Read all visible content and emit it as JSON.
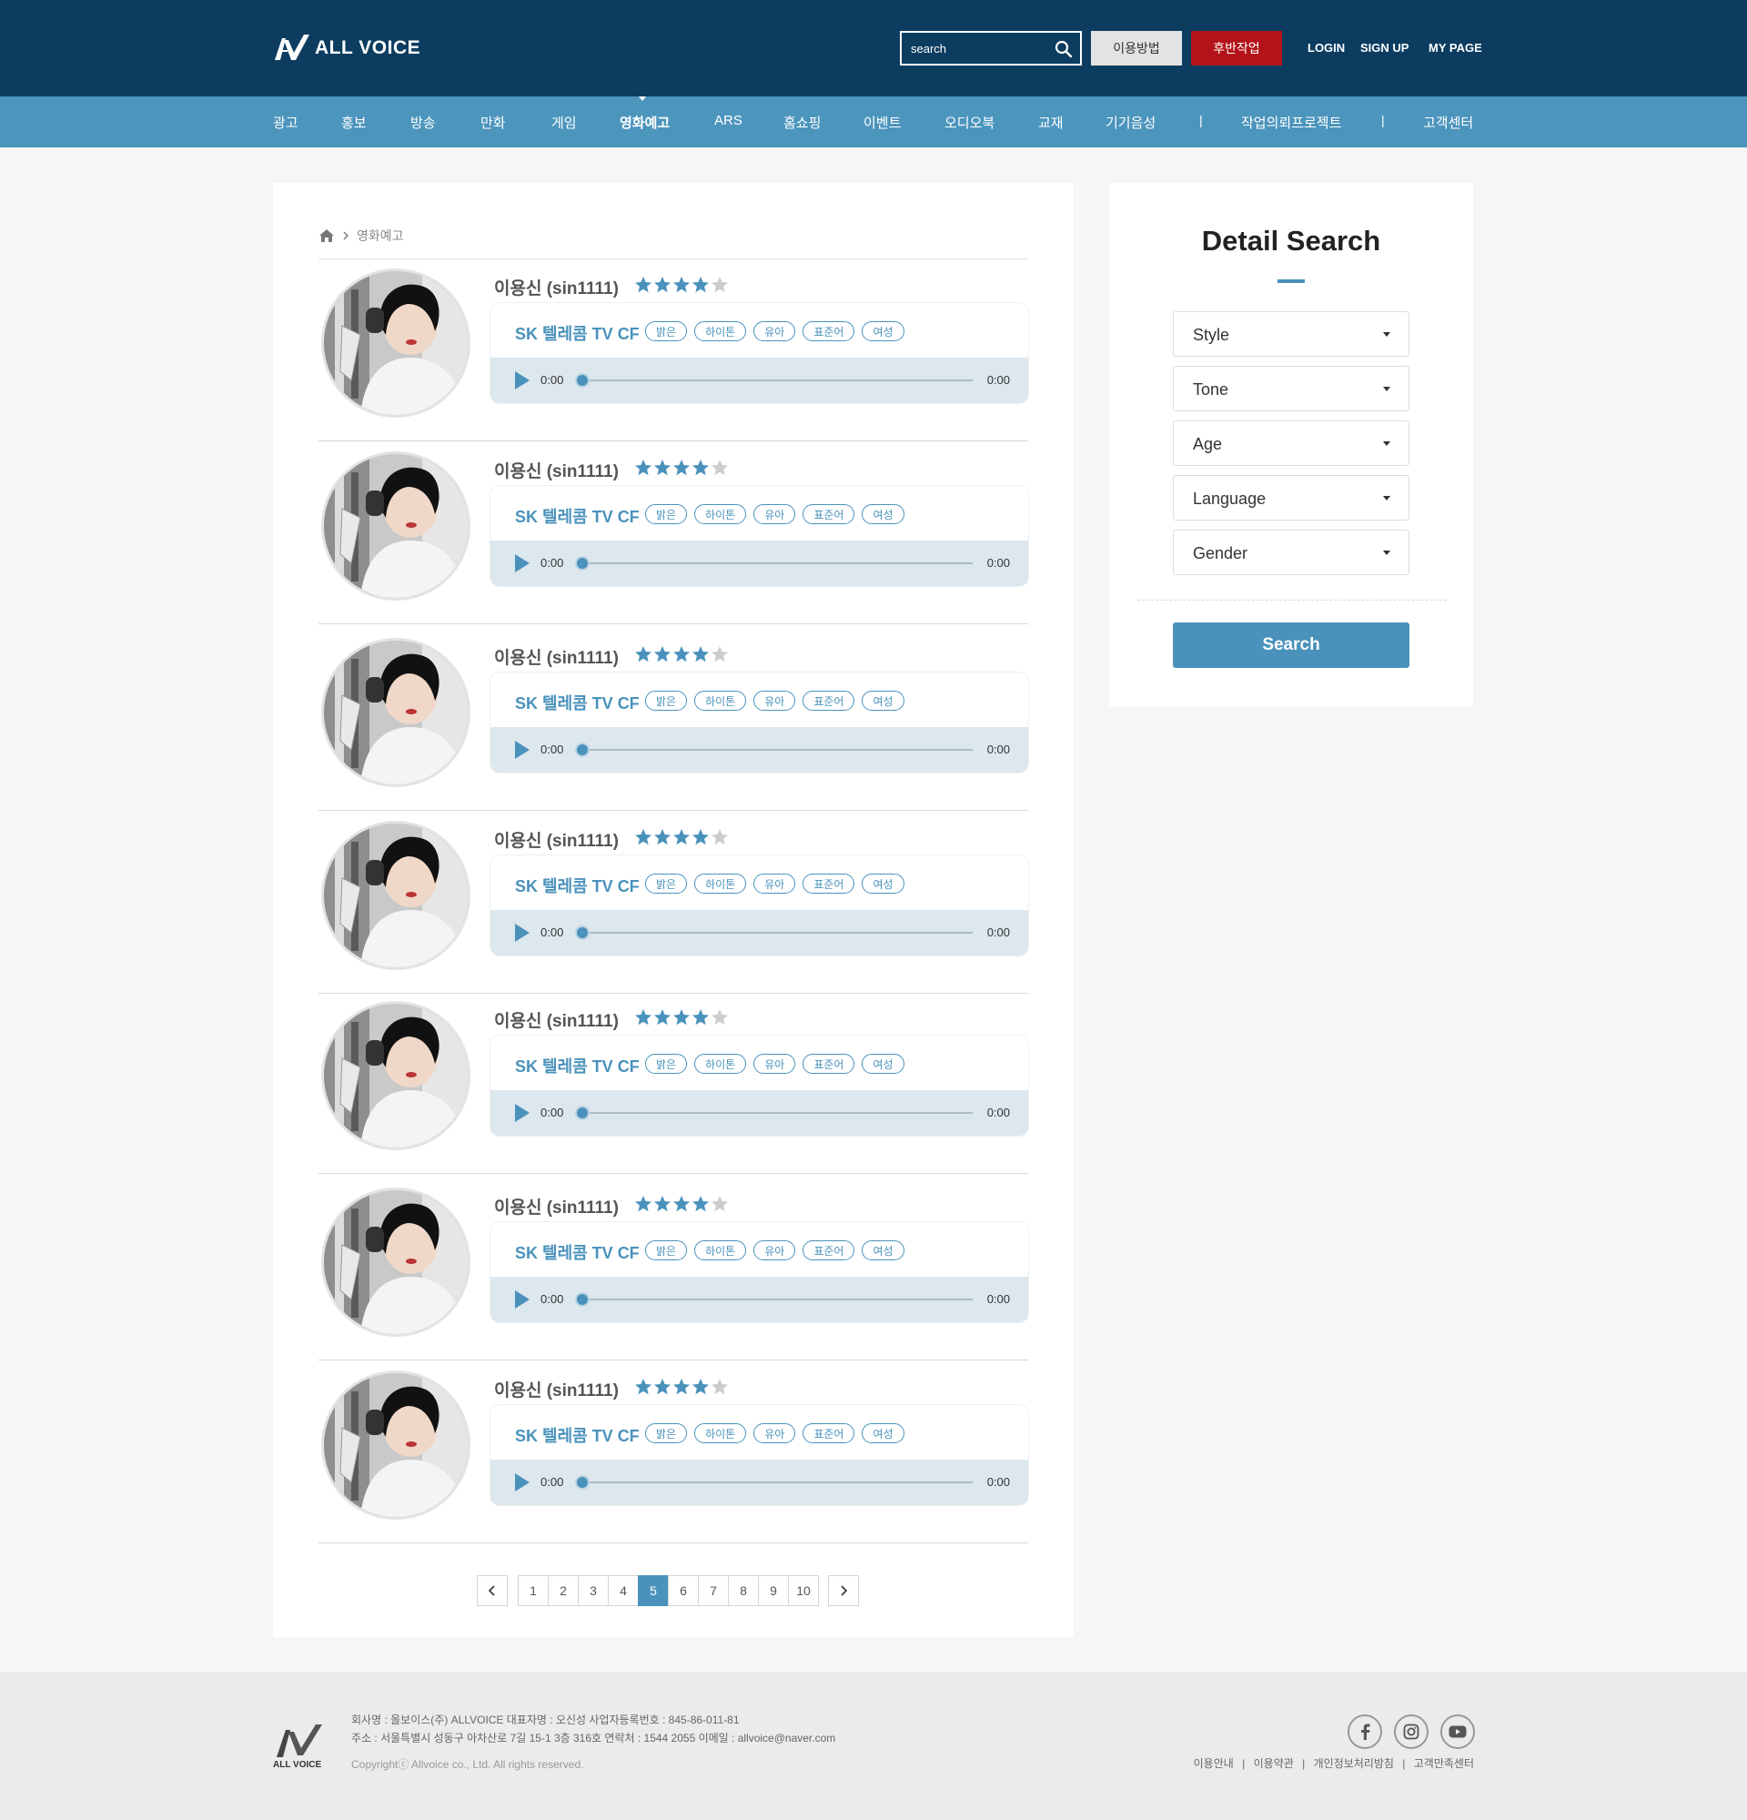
{
  "header": {
    "logo_text": "ALL VOICE",
    "search_placeholder": "search",
    "btn_guide": "이용방법",
    "btn_post": "후반작업",
    "link_login": "LOGIN",
    "link_signup": "SIGN UP",
    "link_mypage": "MY PAGE"
  },
  "nav": {
    "items": [
      "광고",
      "홍보",
      "방송",
      "만화",
      "게임",
      "영화예고",
      "ARS",
      "홈쇼핑",
      "이벤트",
      "오디오북",
      "교재",
      "기기음성",
      "작업의뢰프로젝트",
      "고객센터"
    ],
    "separator": "|",
    "active": "영화예고"
  },
  "breadcrumb": {
    "current": "영화예고"
  },
  "items": [
    {
      "name": "이용신 (sin1111)",
      "rating": 4,
      "title": "SK 텔레콤 TV CF",
      "tags": [
        "밝은",
        "하이톤",
        "유아",
        "표준어",
        "여성"
      ],
      "current_time": "0:00",
      "duration": "0:00"
    },
    {
      "name": "이용신 (sin1111)",
      "rating": 4,
      "title": "SK 텔레콤 TV CF",
      "tags": [
        "밝은",
        "하이톤",
        "유아",
        "표준어",
        "여성"
      ],
      "current_time": "0:00",
      "duration": "0:00"
    },
    {
      "name": "이용신 (sin1111)",
      "rating": 4,
      "title": "SK 텔레콤 TV CF",
      "tags": [
        "밝은",
        "하이톤",
        "유아",
        "표준어",
        "여성"
      ],
      "current_time": "0:00",
      "duration": "0:00"
    },
    {
      "name": "이용신 (sin1111)",
      "rating": 4,
      "title": "SK 텔레콤 TV CF",
      "tags": [
        "밝은",
        "하이톤",
        "유아",
        "표준어",
        "여성"
      ],
      "current_time": "0:00",
      "duration": "0:00"
    },
    {
      "name": "이용신 (sin1111)",
      "rating": 4,
      "title": "SK 텔레콤 TV CF",
      "tags": [
        "밝은",
        "하이톤",
        "유아",
        "표준어",
        "여성"
      ],
      "current_time": "0:00",
      "duration": "0:00"
    },
    {
      "name": "이용신 (sin1111)",
      "rating": 4,
      "title": "SK 텔레콤 TV CF",
      "tags": [
        "밝은",
        "하이톤",
        "유아",
        "표준어",
        "여성"
      ],
      "current_time": "0:00",
      "duration": "0:00"
    },
    {
      "name": "이용신 (sin1111)",
      "rating": 4,
      "title": "SK 텔레콤 TV CF",
      "tags": [
        "밝은",
        "하이톤",
        "유아",
        "표준어",
        "여성"
      ],
      "current_time": "0:00",
      "duration": "0:00"
    }
  ],
  "pagination": {
    "pages": [
      "1",
      "2",
      "3",
      "4",
      "5",
      "6",
      "7",
      "8",
      "9",
      "10"
    ],
    "current": "5"
  },
  "detail_search": {
    "title": "Detail Search",
    "filters": [
      "Style",
      "Tone",
      "Age",
      "Language",
      "Gender"
    ],
    "button": "Search"
  },
  "footer": {
    "logo_text": "ALL VOICE",
    "line1": "회사명 : 올보이스(주) ALLVOICE  대표자명 : 오신성  사업자등록번호 : 845-86-011-81",
    "line2": "주소 : 서울특별시 성동구 아차산로 7길 15-1 3층 316호  연락처 : 1544 2055  이메일 : allvoice@naver.com",
    "copyright": "Copyrightⓒ Allvoice co., Ltd. All rights reserved.",
    "links": [
      "이용안내",
      "이용약관",
      "개인정보처리방침",
      "고객만족센터"
    ],
    "social": [
      "facebook-icon",
      "instagram-icon",
      "youtube-icon"
    ]
  },
  "colors": {
    "header_bg": "#0c3d60",
    "nav_bg": "#4c95bd",
    "accent": "#4a92bb",
    "post_button": "#b41319"
  }
}
